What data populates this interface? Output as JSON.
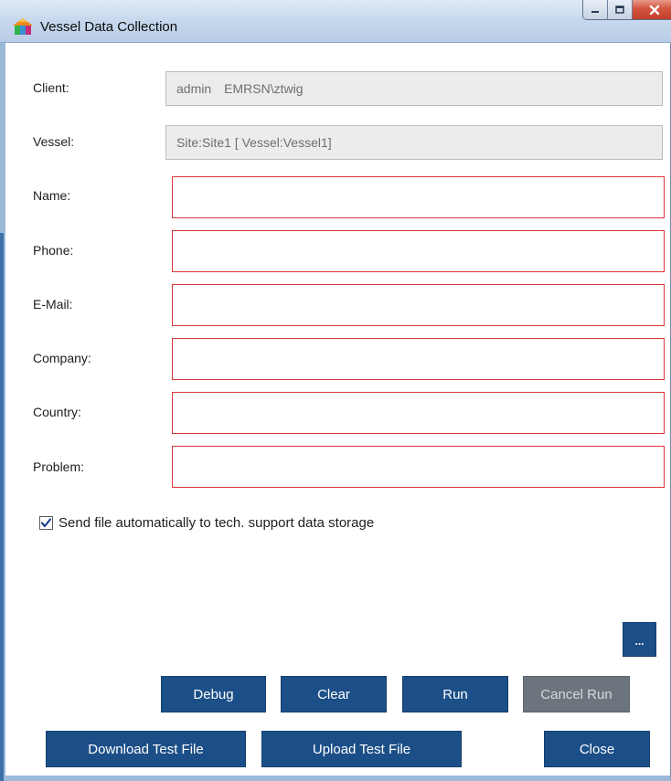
{
  "window": {
    "title": "Vessel Data Collection",
    "icon": "app-house-icon"
  },
  "form": {
    "client": {
      "label": "Client:",
      "user": "admin",
      "account": "EMRSN\\ztwig"
    },
    "vessel": {
      "label": "Vessel:",
      "value": "Site:Site1 [ Vessel:Vessel1]"
    },
    "name": {
      "label": "Name:",
      "value": ""
    },
    "phone": {
      "label": "Phone:",
      "value": ""
    },
    "email": {
      "label": "E-Mail:",
      "value": ""
    },
    "company": {
      "label": "Company:",
      "value": ""
    },
    "country": {
      "label": "Country:",
      "value": ""
    },
    "problem": {
      "label": "Problem:",
      "value": ""
    }
  },
  "send_automatically": {
    "checked": true,
    "label": "Send file automatically to tech. support data storage"
  },
  "buttons": {
    "ellipsis": "...",
    "debug": "Debug",
    "clear": "Clear",
    "run": "Run",
    "cancel_run": "Cancel Run",
    "download_test_file": "Download Test File",
    "upload_test_file": "Upload Test File",
    "close": "Close"
  },
  "colors": {
    "button_primary": "#1c4f88",
    "button_disabled": "#6c757d",
    "required_border": "#d9363a",
    "readonly_bg": "#ececec"
  }
}
